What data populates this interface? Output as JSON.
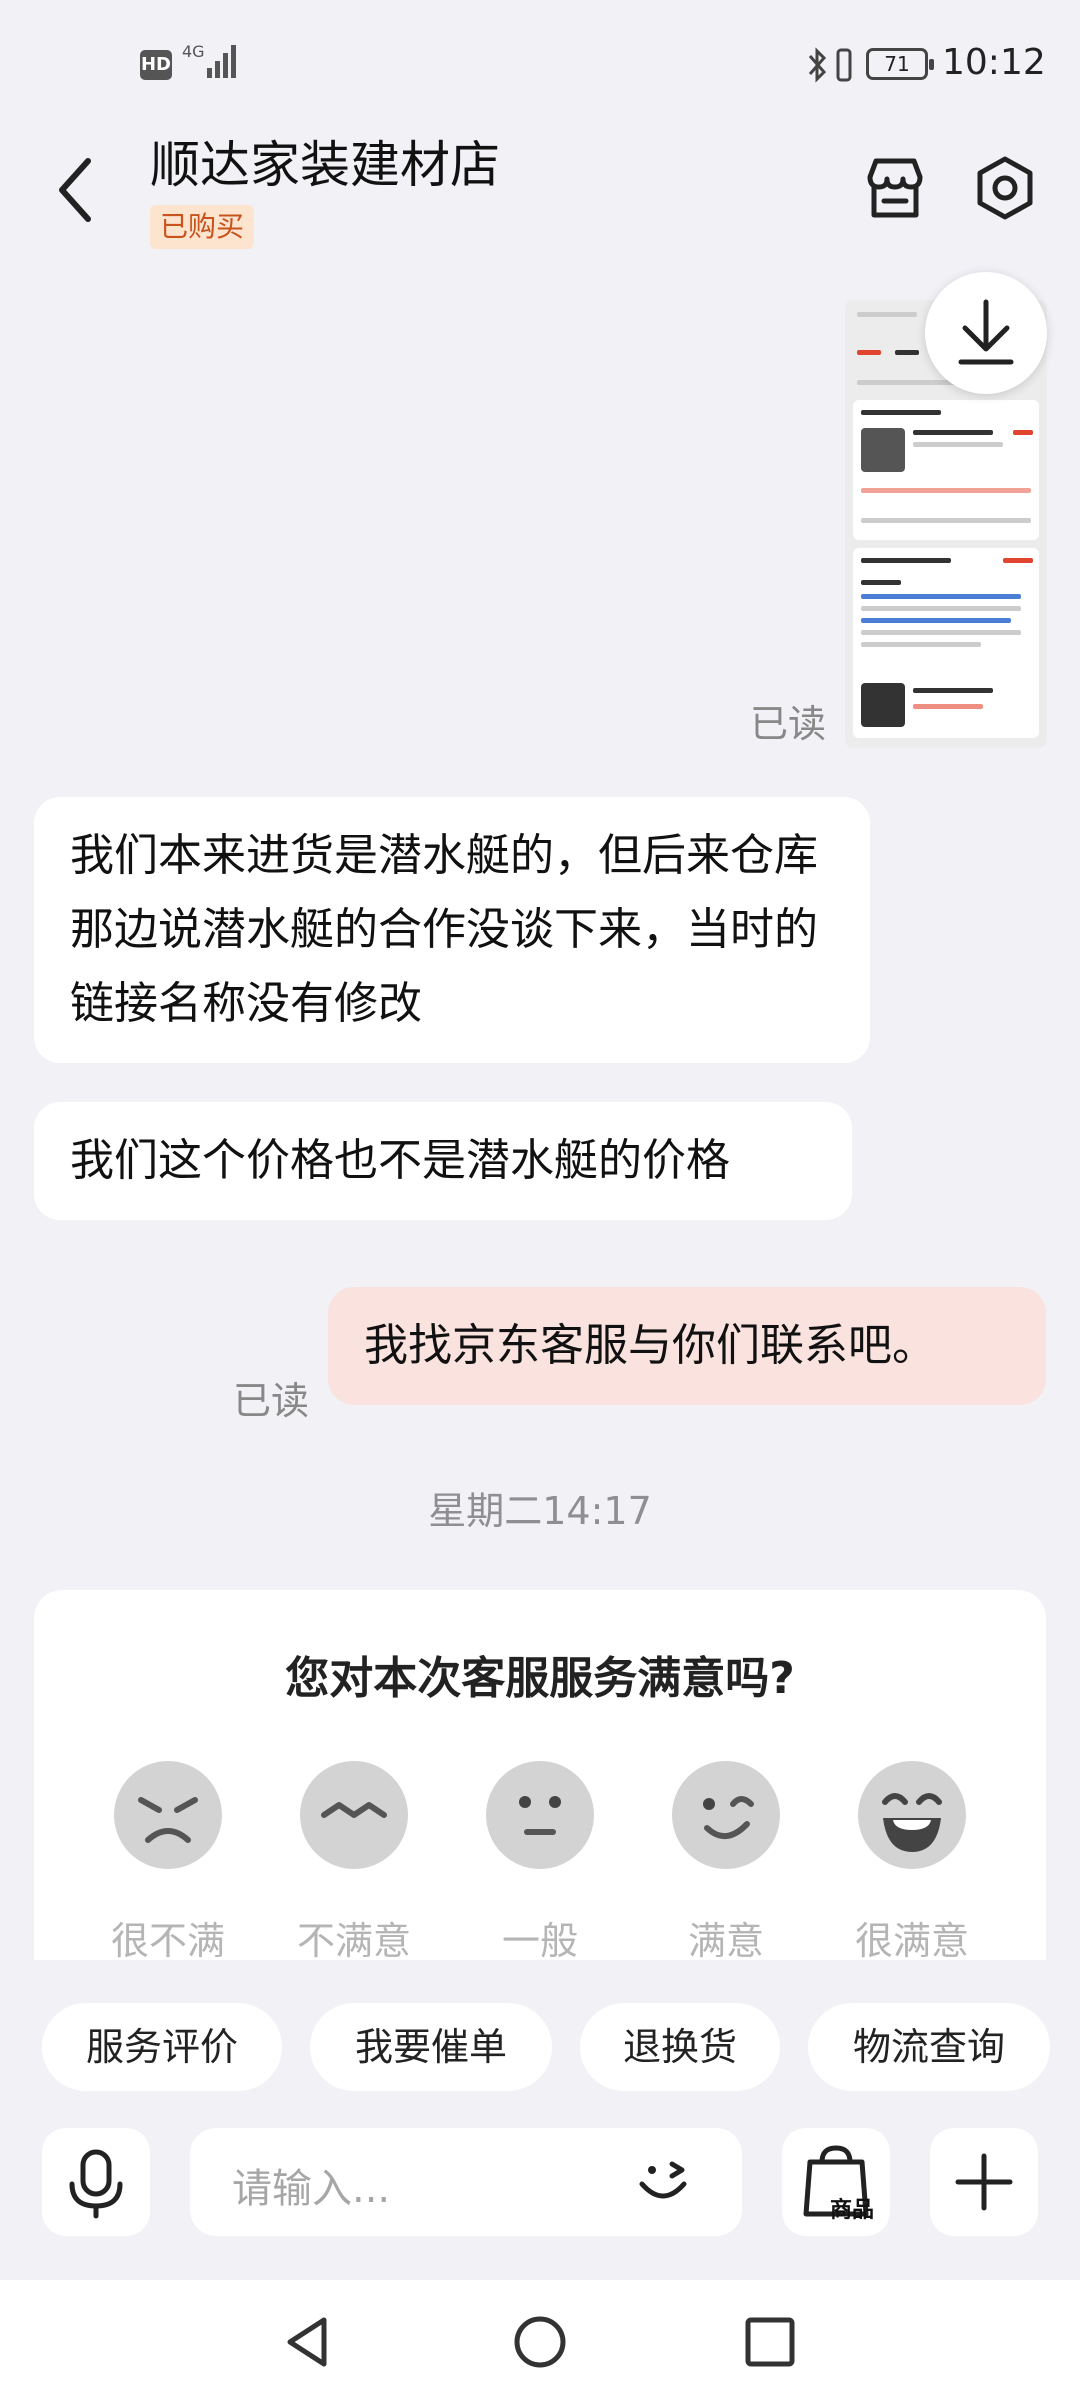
{
  "status_bar": {
    "hd": "HD",
    "network": "4G",
    "battery": "71",
    "time": "10:12"
  },
  "header": {
    "shop_name": "顺达家装建材店",
    "badge": "已购买"
  },
  "messages": [
    {
      "text": "我们本来进货是潜水艇的，但后来仓库那边说潜水艇的合作没谈下来，当时的链接名称没有修改",
      "sender": "shop"
    },
    {
      "text": "我们这个价格也不是潜水艇的价格",
      "sender": "shop"
    },
    {
      "text": "我找京东客服与你们联系吧。",
      "sender": "user"
    }
  ],
  "read_label": "已读",
  "timestamp": "星期二14:17",
  "survey": {
    "question": "您对本次客服服务满意吗?",
    "options": [
      "很不满",
      "不满意",
      "一般",
      "满意",
      "很满意"
    ]
  },
  "quick_actions": [
    "服务评价",
    "我要催单",
    "退换货",
    "物流查询"
  ],
  "input": {
    "placeholder": "请输入...",
    "goods_label": "商品"
  },
  "icons": {
    "back": "back-chevron-icon",
    "store": "store-icon",
    "settings": "settings-icon",
    "download": "download-icon",
    "voice": "microphone-icon",
    "emoji": "emoji-icon",
    "goods": "shopping-bag-icon",
    "more": "plus-icon"
  },
  "colors": {
    "background": "#f1f1f6",
    "user_bubble": "#fae3df",
    "badge_bg": "#fde4cf",
    "badge_text": "#c8531c"
  }
}
